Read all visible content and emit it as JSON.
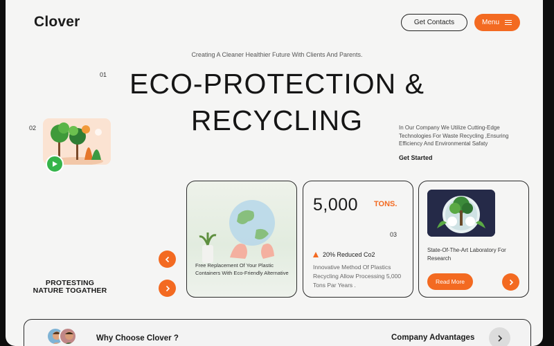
{
  "header": {
    "logo": "Clover",
    "contacts_label": "Get Contacts",
    "menu_label": "Menu"
  },
  "hero": {
    "tagline": "Creating A Cleaner Healthier Future With Clients And Parents.",
    "num1": "01",
    "line1": "ECO-PROTECTION &",
    "line2": "RECYCLING",
    "num2": "02",
    "description": "In Our Company We Utilize Cutting-Edge Technologies For Waste Recycling ,Ensuring Efficiency And Environmental Safaty",
    "cta": "Get Started"
  },
  "side": {
    "protect_line1": "PROTESTING",
    "protect_line2": "NATURE TOGATHER"
  },
  "cards": {
    "card1_text": "Free Replacement Of Your Plastic Containers  With Eco-Friendly Alternative",
    "stat_value": "5,000",
    "stat_unit": "TONS.",
    "card_num": "03",
    "reduced": "20% Reduced Co2",
    "card2_text": "Innovative Method Of Plastics Recycling Allow Processing 5,000 Tons Par Years .",
    "card3_text": "State-Of-The-Art Laboratory For Research",
    "read_more": "Read More"
  },
  "bottom": {
    "why": "Why Choose Clover ?",
    "advantages": "Company Advantages"
  },
  "icons": {
    "menu": "hamburger-icon",
    "play": "play-icon",
    "prev": "chevron-left-icon",
    "next": "chevron-right-icon",
    "up": "triangle-up-icon"
  },
  "colors": {
    "accent": "#f36a21",
    "play": "#35b44a",
    "background": "#f5f5f4"
  }
}
